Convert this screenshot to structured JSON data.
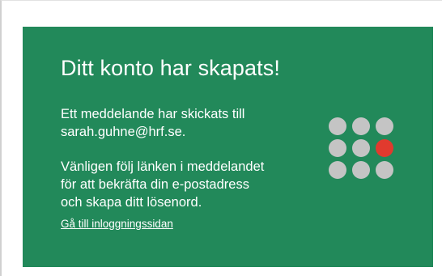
{
  "card": {
    "title": "Ditt konto har skapats!",
    "message1_line1": "Ett meddelande har skickats till",
    "message1_line2": "sarah.guhne@hrf.se.",
    "message2_line1": "Vänligen följ länken i meddelandet",
    "message2_line2": "för att bekräfta din e-postadress",
    "message2_line3": "och skapa ditt lösenord.",
    "login_link": "Gå till inloggningssidan"
  },
  "logo": {
    "icon": "dot-grid-logo-icon",
    "dot_color": "#c4c4c4",
    "highlight_color": "#e13a2e"
  },
  "colors": {
    "card_background": "#22895a",
    "text": "#ffffff"
  }
}
